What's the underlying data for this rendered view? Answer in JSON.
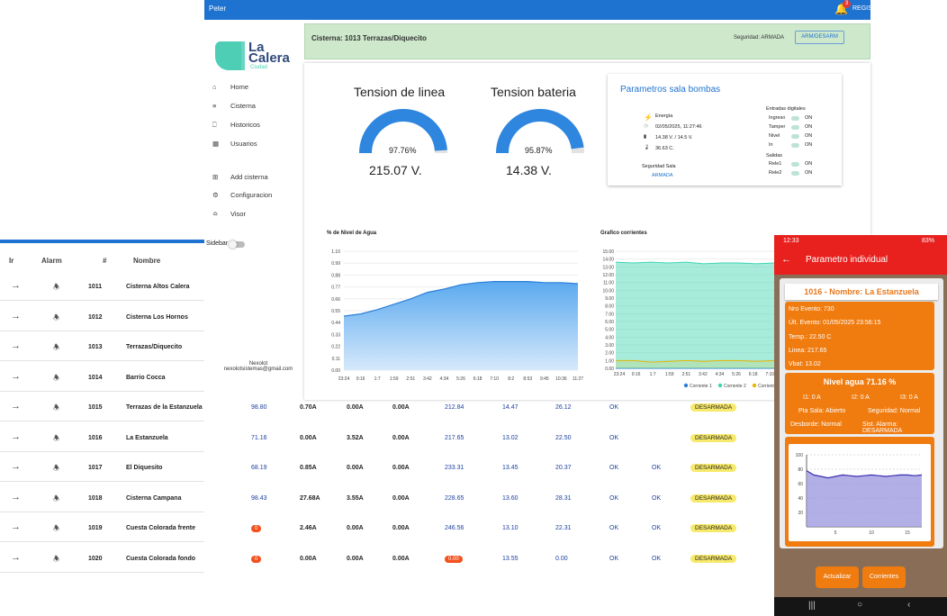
{
  "topbar": {
    "user": "Peter",
    "badge": "3",
    "register": "REGIS"
  },
  "logo": {
    "brand": "La",
    "brand2": "Calera",
    "sub": "Ciudad"
  },
  "nav": [
    {
      "icon": "home-icon",
      "label": "Home"
    },
    {
      "icon": "list-icon",
      "label": "Cisterna"
    },
    {
      "icon": "history-icon",
      "label": "Historicos"
    },
    {
      "icon": "users-icon",
      "label": "Usuarios"
    },
    {
      "icon": "add-icon",
      "label": "Add cisterna"
    },
    {
      "icon": "gear-icon",
      "label": "Configuracion"
    },
    {
      "icon": "view-icon",
      "label": "Visor"
    }
  ],
  "sidebar_toggle": "Sidebar",
  "footer": {
    "name": "Nexolot",
    "email": "nexolotsistemas@gmail.com"
  },
  "cisterna_bar": {
    "title": "Cisterna: 1013 Terrazas/Diquecito",
    "security": "Seguridad: ARMADA",
    "button": "ARM/DESARM"
  },
  "gauges": [
    {
      "title": "Tension de linea",
      "pct_label": "97.76%",
      "pct": 0.9776,
      "value": "215.07 V."
    },
    {
      "title": "Tension bateria",
      "pct_label": "95.87%",
      "pct": 0.9587,
      "value": "14.38 V."
    }
  ],
  "params": {
    "title": "Parametros sala bombas",
    "energia": "Energía",
    "datetime": "02/05/2025, 11:27:46",
    "voltages": "14.38 V. / 14.5 V.",
    "temp": "36.63 C.",
    "seg_label": "Seguridad Sala",
    "seg_value": "ARMADA",
    "entradas_label": "Entradas digitales",
    "entradas": [
      {
        "name": "Ingreso",
        "v": "ON"
      },
      {
        "name": "Tamper",
        "v": "ON"
      },
      {
        "name": "Nivel",
        "v": "ON"
      },
      {
        "name": "In",
        "v": "ON"
      }
    ],
    "salidas_label": "Salidas",
    "salidas": [
      {
        "name": "Rele1",
        "v": "ON"
      },
      {
        "name": "Rele2",
        "v": "ON"
      }
    ]
  },
  "chart_data": [
    {
      "type": "area",
      "title": "% de Nivel de Agua",
      "categories": [
        "23:24",
        "0:16",
        "1:7",
        "1:59",
        "2:51",
        "3:42",
        "4:34",
        "5:26",
        "6:18",
        "7:10",
        "8:2",
        "8:53",
        "9:45",
        "10:36",
        "11:27"
      ],
      "ylim": [
        0,
        1.1
      ],
      "yticks": [
        "1.10",
        "0.99",
        "0.88",
        "0.77",
        "0.66",
        "0.55",
        "0.44",
        "0.33",
        "0.22",
        "0.11",
        "0.00"
      ],
      "series": [
        {
          "values": [
            0.5,
            0.52,
            0.56,
            0.61,
            0.66,
            0.72,
            0.75,
            0.79,
            0.81,
            0.82,
            0.82,
            0.82,
            0.81,
            0.81,
            0.8
          ]
        }
      ]
    },
    {
      "type": "area",
      "title": "Grafico corrientes",
      "categories": [
        "23:24",
        "0:16",
        "1:7",
        "1:59",
        "2:51",
        "3:42",
        "4:34",
        "5:26",
        "6:18",
        "7:10"
      ],
      "ylim": [
        0,
        15
      ],
      "yticks": [
        "15.00",
        "14.00",
        "13.00",
        "12.00",
        "11.00",
        "10.00",
        "9.00",
        "8.00",
        "7.00",
        "6.00",
        "5.00",
        "4.00",
        "3.00",
        "2.00",
        "1.00",
        "0.00"
      ],
      "legend": [
        "Corriente 1",
        "Corriente 2",
        "Corrient"
      ],
      "series": [
        {
          "name": "Corriente 1",
          "color": "#2a7ed8",
          "values": [
            0,
            0,
            0,
            0,
            0,
            0,
            0,
            0,
            0,
            0
          ]
        },
        {
          "name": "Corriente 2",
          "color": "#3bd5b0",
          "values": [
            13.6,
            13.5,
            13.6,
            13.5,
            13.6,
            13.4,
            13.5,
            13.5,
            13.4,
            13.5
          ]
        },
        {
          "name": "Corriente 3",
          "color": "#e8b400",
          "values": [
            1,
            1,
            0.8,
            0.9,
            1,
            0.9,
            1,
            1,
            0.9,
            1
          ]
        }
      ]
    }
  ],
  "table": {
    "headers": [
      "Ir",
      "Alarm",
      "#",
      "Nombre"
    ],
    "rows": [
      {
        "num": "1011",
        "name": "Cisterna Altos Calera"
      },
      {
        "num": "1012",
        "name": "Cisterna Los Hornos"
      },
      {
        "num": "1013",
        "name": "Terrazas/Diquecito"
      },
      {
        "num": "1014",
        "name": "Barrio Cocca"
      },
      {
        "num": "1015",
        "name": "Terrazas de la Estanzuela",
        "nivel": "98.80",
        "i1": "0.70A",
        "i2": "0.00A",
        "i3": "0.00A",
        "v": "212.84",
        "vb": "14.47",
        "t": "26.12",
        "s1": "OK",
        "s2": "",
        "estado": "DESARMADA"
      },
      {
        "num": "1016",
        "name": "La Estanzuela",
        "nivel": "71.16",
        "i1": "0.00A",
        "i2": "3.52A",
        "i3": "0.00A",
        "v": "217.65",
        "vb": "13.02",
        "t": "22.50",
        "s1": "OK",
        "s2": "",
        "estado": "DESARMADA"
      },
      {
        "num": "1017",
        "name": "El Diquesito",
        "nivel": "68.19",
        "i1": "0.85A",
        "i2": "0.00A",
        "i3": "0.00A",
        "v": "233.31",
        "vb": "13.45",
        "t": "20.37",
        "s1": "OK",
        "s2": "OK",
        "estado": "DESARMADA"
      },
      {
        "num": "1018",
        "name": "Cisterna Campana",
        "nivel": "98.43",
        "i1": "27.68A",
        "i2": "3.55A",
        "i3": "0.00A",
        "v": "228.65",
        "vb": "13.60",
        "t": "28.31",
        "s1": "OK",
        "s2": "OK",
        "estado": "DESARMADA"
      },
      {
        "num": "1019",
        "name": "Cuesta Colorada frente",
        "nivel": "0",
        "i1": "2.46A",
        "i2": "0.00A",
        "i3": "0.00A",
        "v": "246.56",
        "vb": "13.10",
        "t": "22.31",
        "s1": "OK",
        "s2": "OK",
        "estado": "DESARMADA"
      },
      {
        "num": "1020",
        "name": "Cuesta Colorada fondo",
        "nivel": "0",
        "i1": "0.00A",
        "i2": "0.00A",
        "i3": "0.00A",
        "v": "0.00",
        "vb": "13.55",
        "t": "0.00",
        "s1": "OK",
        "s2": "OK",
        "estado": "DESARMADA"
      }
    ]
  },
  "phone": {
    "status_time": "12:33",
    "status_right": "83%",
    "title": "Parametro individual",
    "card_title": "1016 - Nombre: La Estanzuela",
    "lines": [
      "Nro Evento: 730",
      "Últ. Evento: 01/05/2025 23:56:15",
      "Temp.: 22.50 C",
      "Linea: 217.65",
      "Vbat: 13.02"
    ],
    "nivel": "Nivel agua 71.16 %",
    "i1": "I1: 0 A",
    "i2": "I2: 0 A",
    "i3": "I3: 0 A",
    "pta": "Pta Sala: Abierto",
    "seg": "Seguridad: Normal",
    "desb": "Desborde: Normal",
    "sist": "Sist. Alarma: DESARMADA",
    "btn1": "Actualizar",
    "btn2": "Corrientes",
    "mini_chart": {
      "yticks": [
        "100",
        "80",
        "60",
        "40",
        "20"
      ],
      "xticks": [
        "5",
        "10",
        "15"
      ],
      "values": [
        78,
        72,
        70,
        68,
        70,
        72,
        71,
        70,
        71,
        72,
        71,
        70,
        71,
        72,
        72,
        71,
        72
      ]
    }
  }
}
